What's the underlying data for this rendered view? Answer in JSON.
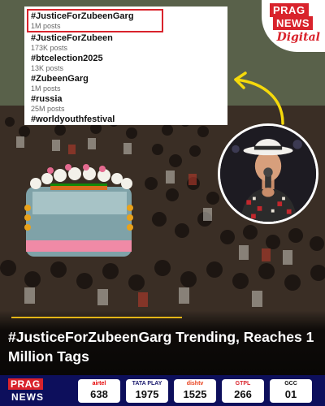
{
  "trending": {
    "items": [
      {
        "tag": "#JusticeForZubeenGarg",
        "count": "1M posts",
        "highlighted": true
      },
      {
        "tag": "#JusticeForZubeen",
        "count": "173K posts"
      },
      {
        "tag": "#btcelection2025",
        "count": "13K posts"
      },
      {
        "tag": "#ZubeenGarg",
        "count": "1M posts"
      },
      {
        "tag": "#russia",
        "count": "25M posts"
      },
      {
        "tag": "#worldyouthfestival",
        "count": ""
      }
    ]
  },
  "brand": {
    "line1": "PRAG",
    "line2": "NEWS",
    "line3": "Digital",
    "color": "#d9232c"
  },
  "headline": {
    "text": "#JusticeForZubeenGarg Trending, Reaches 1 Million Tags",
    "rule_color": "#e4b517"
  },
  "channel_bar": {
    "logo_top": "PRAG",
    "logo_bottom": "NEWS",
    "background": "#0d0f5c",
    "channels": [
      {
        "brand": "airtel",
        "number": "638",
        "color": "#e40000"
      },
      {
        "brand": "TATA PLAY",
        "number": "1975",
        "color": "#1a1a6e"
      },
      {
        "brand": "dishtv",
        "number": "1525",
        "color": "#e8401c"
      },
      {
        "brand": "GTPL",
        "number": "266",
        "color": "#d9232c"
      },
      {
        "brand": "GCC",
        "number": "01",
        "color": "#111111"
      }
    ]
  }
}
